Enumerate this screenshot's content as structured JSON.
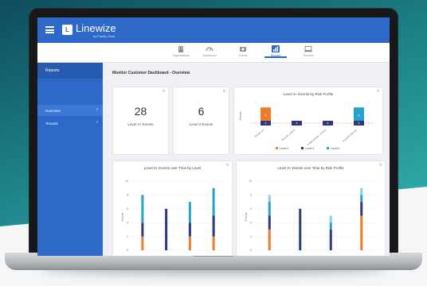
{
  "app": {
    "logo_mark": "L",
    "name": "Linewize",
    "sub": "by Family Zone"
  },
  "nav": {
    "tabs": [
      {
        "label": "Organisations",
        "icon": "building-icon"
      },
      {
        "label": "Dashboard",
        "icon": "dashboard-gauge-icon"
      },
      {
        "label": "Events",
        "icon": "camera-icon"
      },
      {
        "label": "Reports",
        "icon": "bar-chart-icon",
        "active": true
      },
      {
        "label": "Devices",
        "icon": "devices-icon"
      }
    ]
  },
  "sidebar": {
    "header": "Reports",
    "items": [
      {
        "label": "Overview",
        "chevron": "›",
        "active": true
      },
      {
        "label": "Tenants",
        "chevron": "›"
      }
    ]
  },
  "main": {
    "title": "Monitor Customer Dashboard - Overview",
    "stats": [
      {
        "value": "28",
        "label": "Level 3+ Events"
      },
      {
        "value": "6",
        "label": "Level 3 Events"
      }
    ],
    "gear_glyph": "⚙"
  },
  "colors": {
    "accent": "#2e68c8",
    "level3": "#f07c2b",
    "level4": "#2f3a7d",
    "level5": "#27a3c9"
  },
  "chart_data": [
    {
      "type": "bar",
      "title": "Level 3+ Events by Risk Profile",
      "ylabel": "Events",
      "categories": [
        "Violent act",
        "Sexual content",
        "Inappropriate content",
        "Suicidal distress"
      ],
      "series": [
        {
          "name": "Level 3",
          "values": [
            6,
            0,
            0,
            0
          ]
        },
        {
          "name": "Level 4",
          "values": [
            4,
            4,
            4,
            4
          ]
        },
        {
          "name": "Level 5",
          "values": [
            0,
            0,
            0,
            6
          ]
        }
      ],
      "bar_labels": [
        "6",
        "4",
        "4",
        "4",
        "4",
        "6"
      ],
      "legend": "bottom"
    },
    {
      "type": "bar",
      "title": "Level 3+ Events over Time by Level",
      "ylabel": "Events",
      "yticks": [
        "0",
        "2",
        "4",
        "6",
        "8",
        "10"
      ],
      "ylim": [
        0,
        10
      ],
      "series": [
        {
          "name": "Level 3",
          "values": [
            2,
            0,
            2,
            2
          ]
        },
        {
          "name": "Level 4",
          "values": [
            2,
            6,
            2,
            3
          ]
        },
        {
          "name": "Level 5",
          "values": [
            4,
            0,
            3,
            4
          ]
        }
      ]
    },
    {
      "type": "bar",
      "title": "Level 3+ Events over Time by Risk Profile",
      "ylabel": "Events",
      "yticks": [
        "0",
        "2",
        "4",
        "6",
        "8",
        "10"
      ],
      "ylim": [
        0,
        10
      ],
      "series": [
        {
          "values": [
            3,
            0,
            0,
            5
          ]
        },
        {
          "values": [
            2,
            6,
            3,
            2
          ]
        },
        {
          "values": [
            2,
            0,
            1,
            1
          ]
        },
        {
          "values": [
            1,
            0,
            1,
            1
          ]
        }
      ]
    }
  ]
}
